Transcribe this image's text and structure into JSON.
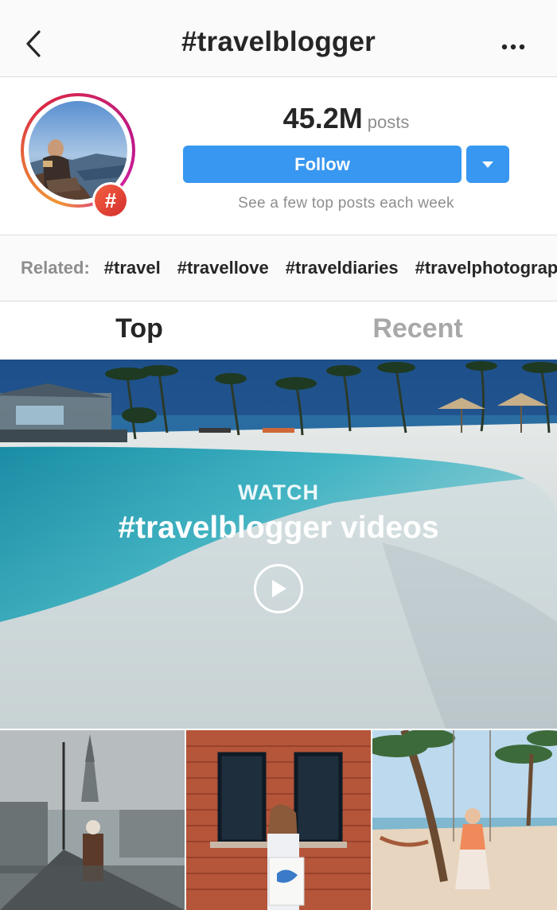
{
  "header": {
    "title": "#travelblogger",
    "back_icon": "chevron-left-icon",
    "more_icon": "more-horizontal-icon"
  },
  "profile": {
    "post_count": "45.2M",
    "post_count_label": "posts",
    "follow_label": "Follow",
    "dropdown_icon": "triangle-down-icon",
    "subtext": "See a few top posts each week",
    "badge_symbol": "#"
  },
  "related": {
    "label": "Related:",
    "tags": [
      "#travel",
      "#travellove",
      "#traveldiaries",
      "#travelphotography"
    ]
  },
  "tabs": {
    "top": "Top",
    "recent": "Recent"
  },
  "banner": {
    "watch_label": "WATCH",
    "title": "#travelblogger videos",
    "play_icon": "play-circle-icon"
  },
  "colors": {
    "accent": "#3897f0",
    "text": "#262626",
    "muted": "#8e8e8e",
    "inactive_tab": "#a8a8a8"
  }
}
